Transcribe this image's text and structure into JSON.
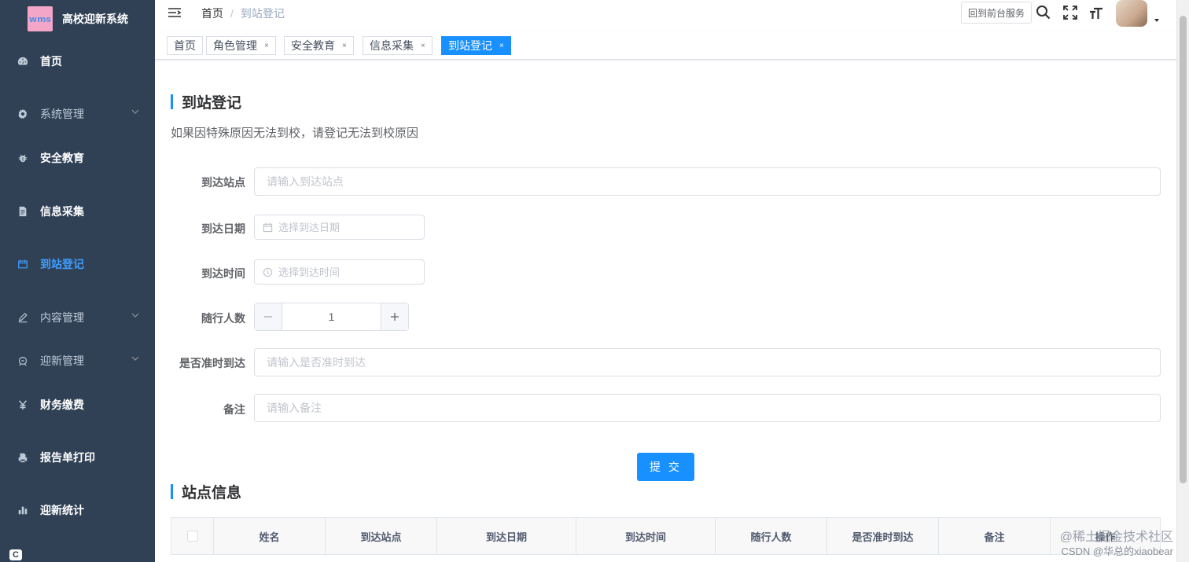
{
  "app": {
    "title": "高校迎新系统",
    "logo_text": "wms"
  },
  "sidebar": {
    "items": [
      {
        "label": "首页",
        "icon": "dashboard-icon"
      },
      {
        "label": "系统管理",
        "icon": "gear-icon",
        "has_submenu": true
      },
      {
        "label": "安全教育",
        "icon": "bug-icon"
      },
      {
        "label": "信息采集",
        "icon": "document-icon"
      },
      {
        "label": "到站登记",
        "icon": "calendar-icon",
        "active": true
      },
      {
        "label": "内容管理",
        "icon": "edit-icon",
        "has_submenu": true
      },
      {
        "label": "迎新管理",
        "icon": "peoples-icon",
        "has_submenu": true
      },
      {
        "label": "财务缴费",
        "icon": "yen-icon"
      },
      {
        "label": "报告单打印",
        "icon": "print-icon"
      },
      {
        "label": "迎新统计",
        "icon": "chart-icon"
      }
    ],
    "bottom_badge": "C"
  },
  "navbar": {
    "breadcrumb": [
      "首页",
      "到站登记"
    ],
    "front_button": "回到前台服务"
  },
  "tags": [
    {
      "label": "首页",
      "closable": false
    },
    {
      "label": "角色管理",
      "closable": true
    },
    {
      "label": "安全教育",
      "closable": true
    },
    {
      "label": "信息采集",
      "closable": true
    },
    {
      "label": "到站登记",
      "closable": true,
      "active": true
    }
  ],
  "tag_close_glyph": "×",
  "form_section": {
    "title": "到站登记",
    "description": "如果因特殊原因无法到校，请登记无法到校原因",
    "fields": {
      "station": {
        "label": "到达站点",
        "placeholder": "请输入到达站点",
        "value": ""
      },
      "date": {
        "label": "到达日期",
        "placeholder": "选择到达日期",
        "value": ""
      },
      "time": {
        "label": "到达时间",
        "placeholder": "选择到达时间",
        "value": ""
      },
      "companions": {
        "label": "随行人数",
        "value": "1"
      },
      "on_time": {
        "label": "是否准时到达",
        "placeholder": "请输入是否准时到达",
        "value": ""
      },
      "remark": {
        "label": "备注",
        "placeholder": "请输入备注",
        "value": ""
      }
    },
    "submit_label": "提 交"
  },
  "table_section": {
    "title": "站点信息",
    "columns": [
      "姓名",
      "到达站点",
      "到达日期",
      "到达时间",
      "随行人数",
      "是否准时到达",
      "备注",
      "操作"
    ]
  },
  "watermark": {
    "line1": "@稀土掘金技术社区",
    "line2": "CSDN @华总的xiaobear"
  },
  "colors": {
    "sidebar_bg": "#304156",
    "accent": "#1890ff",
    "active_menu": "#409eff"
  }
}
